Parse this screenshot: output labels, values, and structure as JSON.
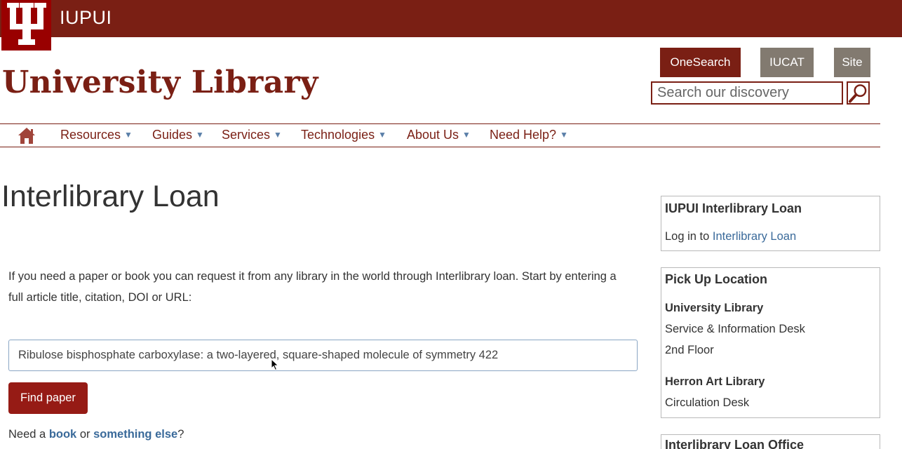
{
  "topbar": {
    "title": "IUPUI"
  },
  "header": {
    "library_title": "University Library"
  },
  "search": {
    "tabs": [
      "OneSearch",
      "IUCAT",
      "Site"
    ],
    "placeholder": "Search our discovery"
  },
  "nav": {
    "items": [
      "Resources",
      "Guides",
      "Services",
      "Technologies",
      "About Us",
      "Need Help?"
    ]
  },
  "main": {
    "title": "Interlibrary Loan",
    "intro": "If you need a paper or book you can request it from any library in the world through Interlibrary loan. Start by entering a full article title, citation, DOI or URL:",
    "query_value": "Ribulose bisphosphate carboxylase: a two-layered, square-shaped molecule of symmetry 422",
    "find_button": "Find paper",
    "need_prefix": "Need a",
    "need_book": "book",
    "need_or": "or",
    "need_else": "something else",
    "need_suffix": "?"
  },
  "sidebar": {
    "box1": {
      "title": "IUPUI Interlibrary Loan",
      "login_prefix": "Log in to",
      "login_link": "Interlibrary Loan"
    },
    "box2": {
      "title": "Pick Up Location",
      "loc1_name": "University Library",
      "loc1_line1": "Service & Information Desk",
      "loc1_line2": "2nd Floor",
      "loc2_name": "Herron Art Library",
      "loc2_line1": "Circulation Desk"
    },
    "box3": {
      "title": "Interlibrary Loan Office"
    }
  },
  "colors": {
    "brand": "#7a1f14",
    "button": "#961b15",
    "gray_tab": "#827a70",
    "link": "#3a6a9a"
  }
}
